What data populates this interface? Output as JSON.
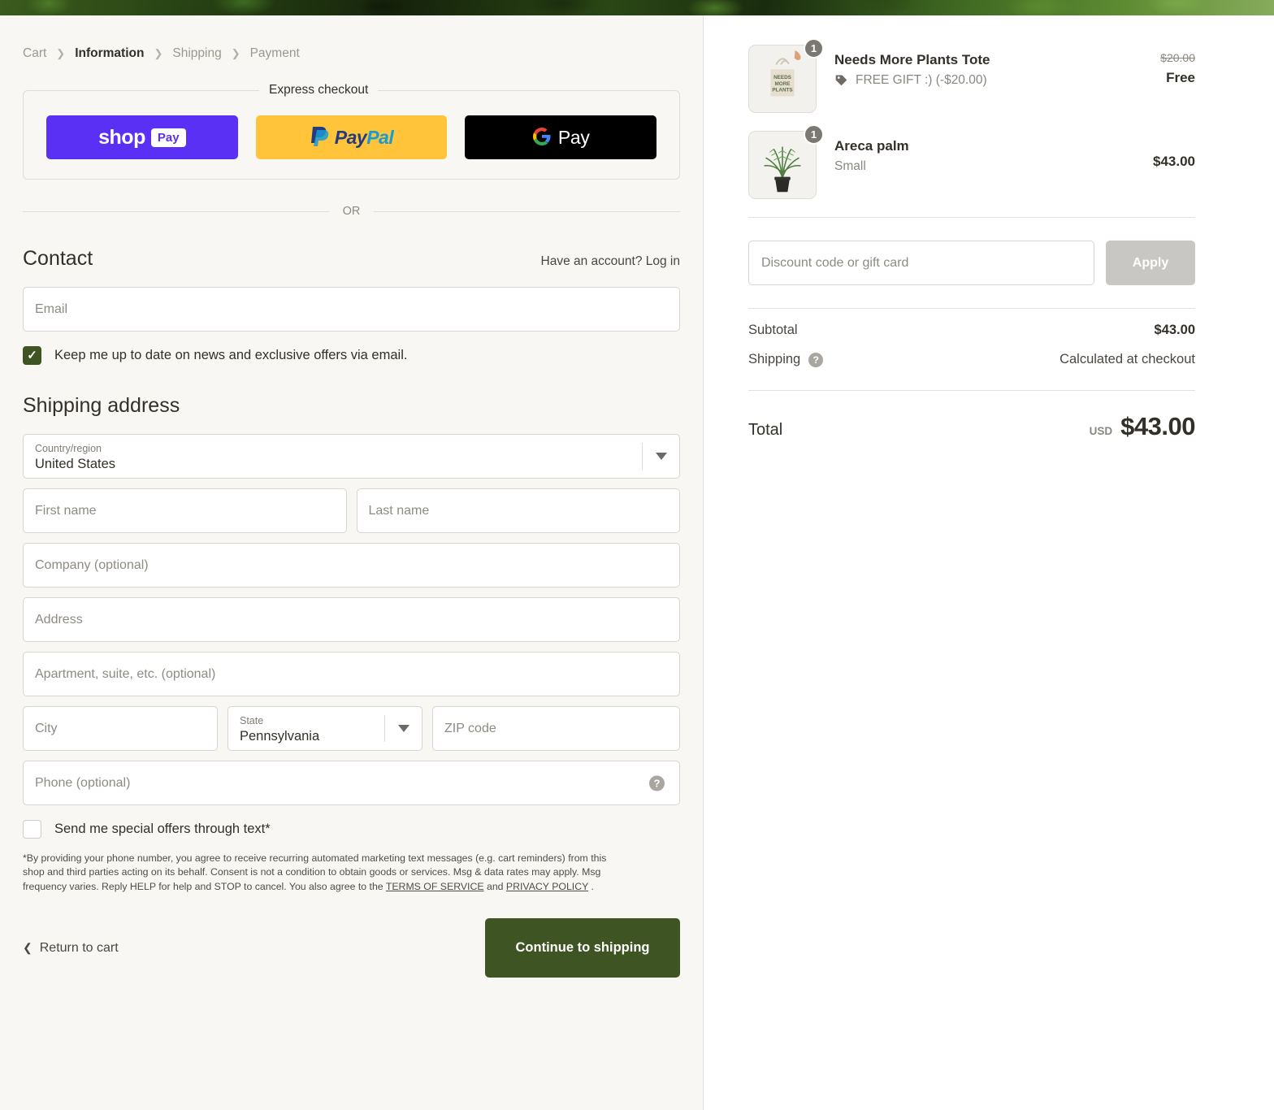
{
  "breadcrumb": [
    {
      "label": "Cart",
      "active": false
    },
    {
      "label": "Information",
      "active": true
    },
    {
      "label": "Shipping",
      "active": false
    },
    {
      "label": "Payment",
      "active": false
    }
  ],
  "express": {
    "legend": "Express checkout",
    "buttons": [
      {
        "id": "shop-pay",
        "word": "shop",
        "badge": "Pay"
      },
      {
        "id": "paypal",
        "pay": "Pay",
        "pal": "Pal"
      },
      {
        "id": "google-pay",
        "text": "Pay"
      }
    ]
  },
  "or_label": "OR",
  "contact": {
    "title": "Contact",
    "login_prompt": "Have an account? Log in",
    "email_placeholder": "Email",
    "newsletter_label": "Keep me up to date on news and exclusive offers via email.",
    "newsletter_checked": true
  },
  "shipping_address": {
    "title": "Shipping address",
    "country": {
      "label": "Country/region",
      "value": "United States"
    },
    "first_name_placeholder": "First name",
    "last_name_placeholder": "Last name",
    "company_placeholder": "Company (optional)",
    "address_placeholder": "Address",
    "apartment_placeholder": "Apartment, suite, etc. (optional)",
    "city_placeholder": "City",
    "state": {
      "label": "State",
      "value": "Pennsylvania"
    },
    "zip_placeholder": "ZIP code",
    "phone_placeholder": "Phone (optional)",
    "sms_label": "Send me special offers through text*",
    "sms_checked": false,
    "fineprint": {
      "part1": "*By providing your phone number, you agree to receive recurring automated marketing text messages (e.g. cart reminders) from this shop and third parties acting on its behalf. Consent is not a condition to obtain goods or services. Msg & data rates may apply. Msg frequency varies. Reply HELP for help and STOP to cancel. You also agree to the ",
      "link1": "TERMS OF SERVICE",
      "part2": " and ",
      "link2": "PRIVACY POLICY",
      "part3": " ."
    }
  },
  "actions": {
    "return_to_cart": "Return to cart",
    "continue": "Continue to shipping"
  },
  "order_summary": {
    "items": [
      {
        "title": "Needs More Plants Tote",
        "quantity": "1",
        "discount_label": "FREE GIFT :) (-$20.00)",
        "original_price": "$20.00",
        "price": "Free",
        "thumb": "tote-bag"
      },
      {
        "title": "Areca palm",
        "quantity": "1",
        "variant": "Small",
        "price": "$43.00",
        "thumb": "potted-palm"
      }
    ],
    "discount": {
      "placeholder": "Discount code or gift card",
      "apply_label": "Apply"
    },
    "subtotal": {
      "label": "Subtotal",
      "value": "$43.00"
    },
    "shipping": {
      "label": "Shipping",
      "value": "Calculated at checkout"
    },
    "total": {
      "label": "Total",
      "currency": "USD",
      "value": "$43.00"
    }
  },
  "colors": {
    "accent_green": "#3f5423",
    "page_cream": "#f8f7f3",
    "shop_pay_purple": "#5a31f4",
    "paypal_yellow": "#ffc439"
  }
}
